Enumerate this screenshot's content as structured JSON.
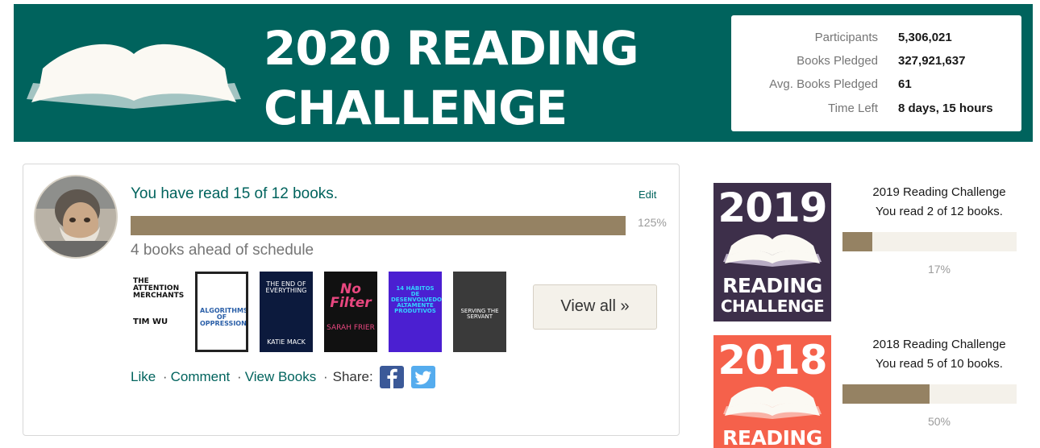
{
  "banner": {
    "title_line1": "2020 READING",
    "title_line2": "CHALLENGE",
    "stats": [
      {
        "label": "Participants",
        "value": "5,306,021"
      },
      {
        "label": "Books Pledged",
        "value": "327,921,637"
      },
      {
        "label": "Avg. Books Pledged",
        "value": "61"
      },
      {
        "label": "Time Left",
        "value": "8 days, 15 hours"
      }
    ]
  },
  "progress": {
    "headline": "You have read 15 of 12 books.",
    "edit_label": "Edit",
    "percent_label": "125%",
    "fill_fraction": 1.0,
    "schedule": "4 books ahead of schedule"
  },
  "books": [
    {
      "title": "THE ATTENTION MERCHANTS",
      "author": "TIM WU",
      "bg": "#ffffff",
      "fg": "#111111"
    },
    {
      "title": "ALGORITHMS OF OPPRESSION",
      "author": "",
      "bg": "#ffffff",
      "fg": "#2a5fa8"
    },
    {
      "title": "THE END OF EVERYTHING",
      "author": "KATIE MACK",
      "bg": "#0c1a3d",
      "fg": "#ffffff"
    },
    {
      "title": "No Filter",
      "author": "SARAH FRIER",
      "bg": "#111111",
      "fg": "#e8477f"
    },
    {
      "title": "14 HÁBITOS DE DESENVOLVEDORES ALTAMENTE PRODUTIVOS",
      "author": "",
      "bg": "#4b1fd1",
      "fg": "#33d1ff"
    },
    {
      "title": "SERVING THE SERVANT",
      "author": "",
      "bg": "#3a3a3a",
      "fg": "#ffffff"
    }
  ],
  "view_all_label": "View all »",
  "actions": {
    "like": "Like",
    "comment": "Comment",
    "view_books": "View Books",
    "share": "Share:"
  },
  "history": [
    {
      "year": "2019",
      "badge_line1": "READING",
      "badge_line2": "CHALLENGE",
      "title": "2019 Reading Challenge",
      "sub": "You read 2 of 12 books.",
      "percent_label": "17%",
      "fill_fraction": 0.17,
      "color": "#3d2f4a"
    },
    {
      "year": "2018",
      "badge_line1": "READING",
      "badge_line2": "",
      "title": "2018 Reading Challenge",
      "sub": "You read 5 of 10 books.",
      "percent_label": "50%",
      "fill_fraction": 0.5,
      "color": "#f5614b"
    }
  ],
  "colors": {
    "brand_green": "#00635d",
    "progress_fill": "#958263",
    "facebook": "#3b5998",
    "twitter": "#55acee"
  },
  "icons": [
    "open-book-icon",
    "facebook-icon",
    "twitter-icon"
  ]
}
